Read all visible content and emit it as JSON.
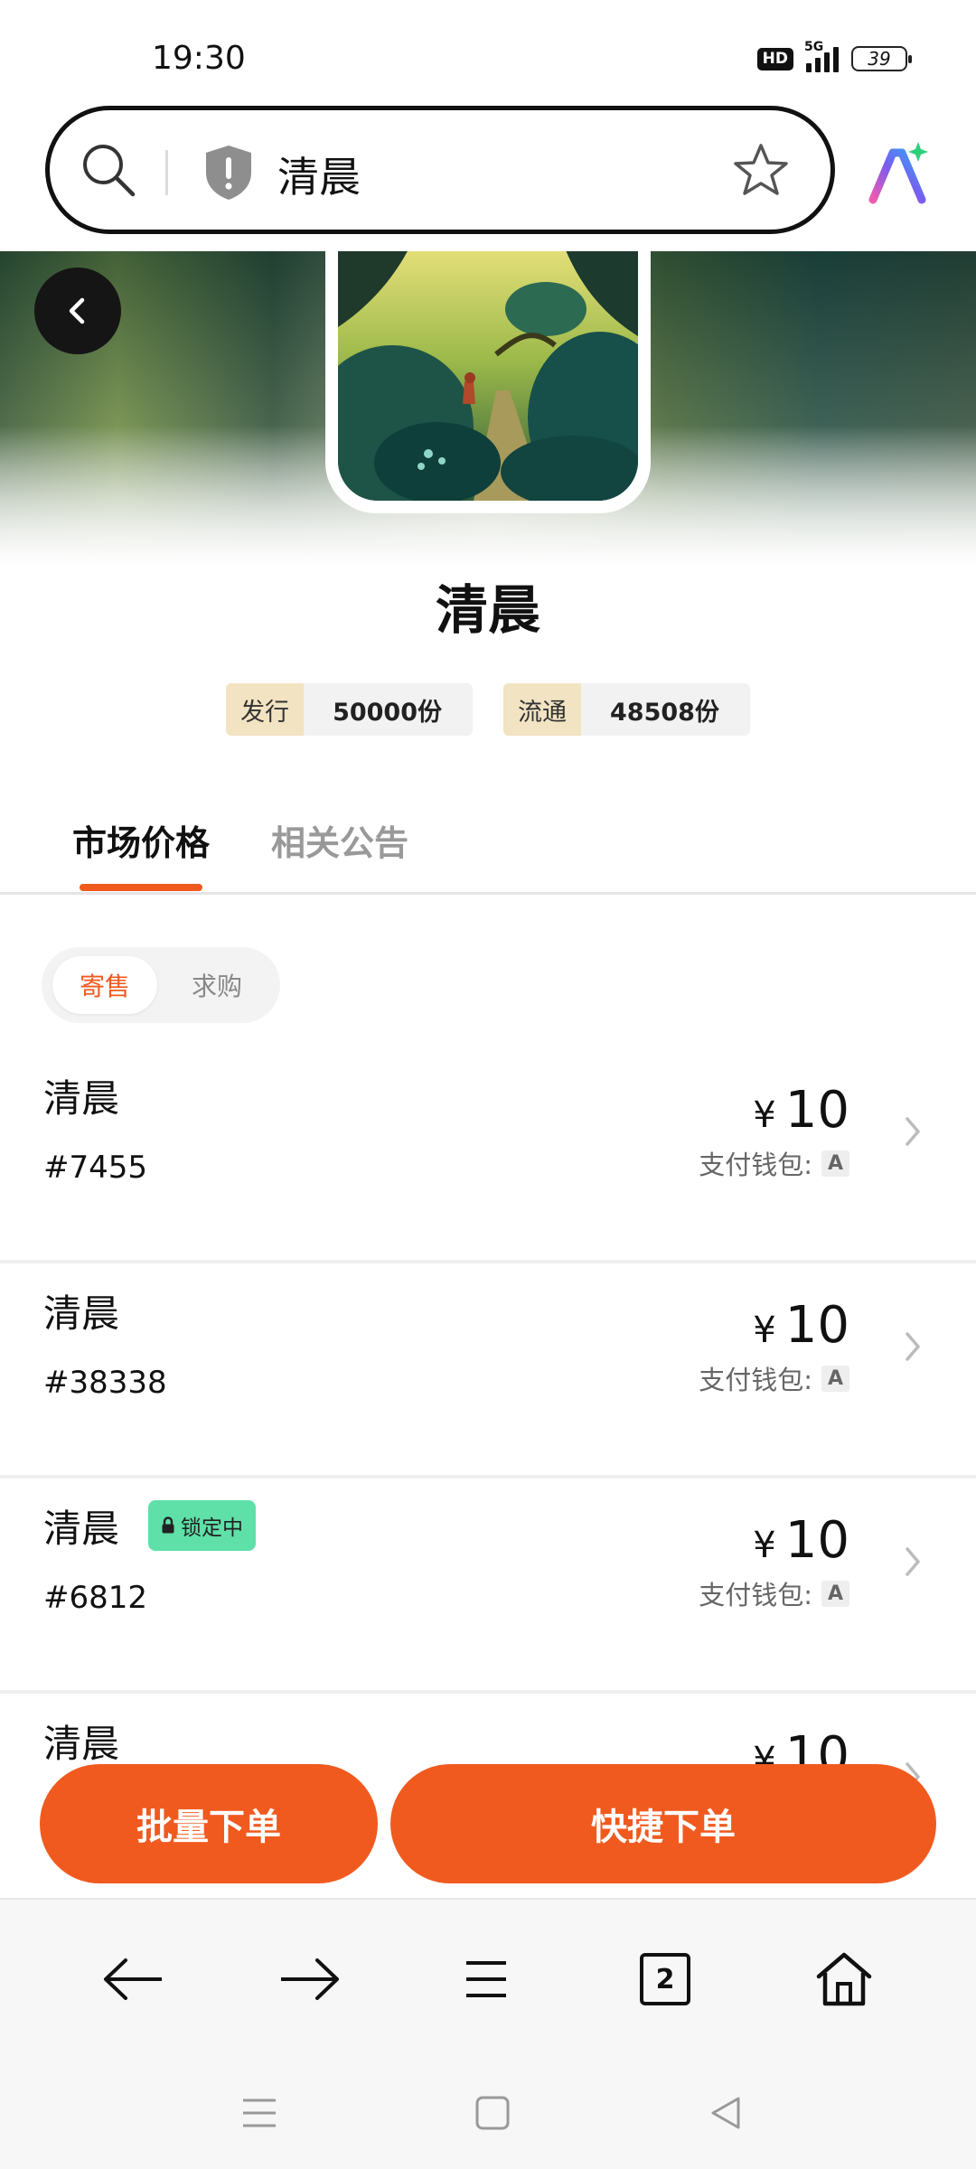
{
  "status_bar": {
    "time": "19:30",
    "hd_label": "HD",
    "network_label": "5G",
    "battery_level": "39"
  },
  "url_bar": {
    "title": "清晨",
    "icons": [
      "search-icon",
      "shield-warning-icon",
      "star-icon",
      "ai-assistant-icon"
    ]
  },
  "collection": {
    "title": "清晨",
    "stats": [
      {
        "label": "发行",
        "value": "50000份"
      },
      {
        "label": "流通",
        "value": "48508份"
      }
    ]
  },
  "tabs": {
    "market_price": "市场价格",
    "announcements": "相关公告"
  },
  "segment": {
    "sell": "寄售",
    "buy": "求购"
  },
  "listings": [
    {
      "name": "清晨",
      "id": "#7455",
      "currency": "¥",
      "price": "10",
      "wallet_label": "支付钱包:",
      "wallet": "A",
      "locked": false
    },
    {
      "name": "清晨",
      "id": "#38338",
      "currency": "¥",
      "price": "10",
      "wallet_label": "支付钱包:",
      "wallet": "A",
      "locked": false
    },
    {
      "name": "清晨",
      "id": "#6812",
      "currency": "¥",
      "price": "10",
      "wallet_label": "支付钱包:",
      "wallet": "A",
      "locked": true,
      "lock_label": "锁定中"
    },
    {
      "name": "清晨",
      "currency": "¥",
      "price": "10"
    }
  ],
  "actions": {
    "batch_order": "批量下单",
    "quick_order": "快捷下单"
  },
  "browser_nav": {
    "tab_count": "2",
    "icons": [
      "back-arrow-icon",
      "forward-arrow-icon",
      "menu-icon",
      "tabs-icon",
      "home-icon"
    ]
  },
  "colors": {
    "accent": "#f05a1f",
    "lock_badge": "#5fe0a8",
    "stat_label_bg": "#f2e3c2"
  }
}
